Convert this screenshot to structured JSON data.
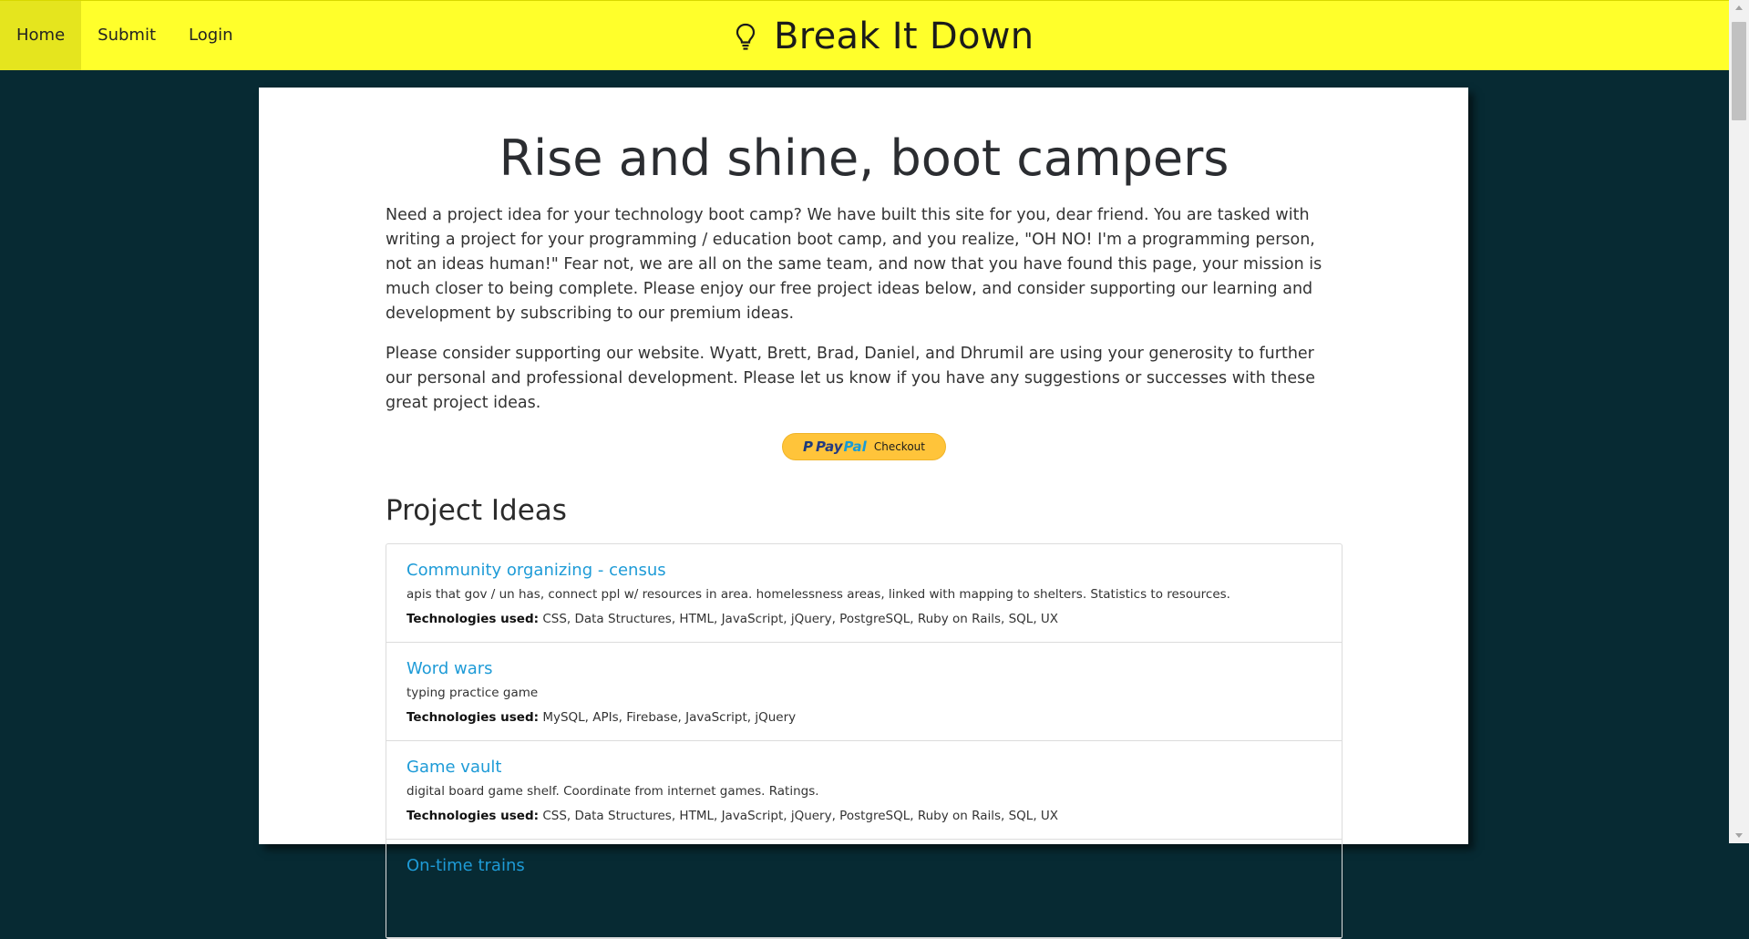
{
  "nav": {
    "items": [
      {
        "label": "Home"
      },
      {
        "label": "Submit"
      },
      {
        "label": "Login"
      }
    ]
  },
  "brand": {
    "title": "Break It Down",
    "icon": "lightbulb-icon"
  },
  "hero": {
    "title": "Rise and shine, boot campers",
    "intro": "Need a project idea for your technology boot camp? We have built this site for you, dear friend. You are tasked with writing a project for your programming / education boot camp, and you realize, \"OH NO! I'm a programming person, not an ideas human!\" Fear not, we are all on the same team, and now that you have found this page, your mission is much closer to being complete. Please enjoy our free project ideas below, and consider supporting our learning and development by subscribing to our premium ideas.",
    "support": "Please consider supporting our website. Wyatt, Brett, Brad, Daniel, and Dhrumil are using your generosity to further our personal and professional development. Please let us know if you have any suggestions or successes with these great project ideas."
  },
  "paypal": {
    "mark": "P",
    "word1": "Pay",
    "word2": "Pal",
    "checkout": "Checkout"
  },
  "projects": {
    "heading": "Project Ideas",
    "tech_label": "Technologies used:",
    "items": [
      {
        "title": "Community organizing - census",
        "description": "apis that gov / un has, connect ppl w/ resources in area. homelessness areas, linked with mapping to shelters. Statistics to resources.",
        "technologies": "CSS, Data Structures, HTML, JavaScript, jQuery, PostgreSQL, Ruby on Rails, SQL, UX"
      },
      {
        "title": "Word wars",
        "description": "typing practice game",
        "technologies": "MySQL, APIs, Firebase, JavaScript, jQuery"
      },
      {
        "title": "Game vault",
        "description": "digital board game shelf. Coordinate from internet games. Ratings.",
        "technologies": "CSS, Data Structures, HTML, JavaScript, jQuery, PostgreSQL, Ruby on Rails, SQL, UX"
      },
      {
        "title": "On-time trains",
        "description": "",
        "technologies": ""
      }
    ]
  },
  "colors": {
    "topbar": "#ffff2b",
    "background": "#072a33",
    "link": "#1e9bd7",
    "paypal": "#ffc43a"
  }
}
